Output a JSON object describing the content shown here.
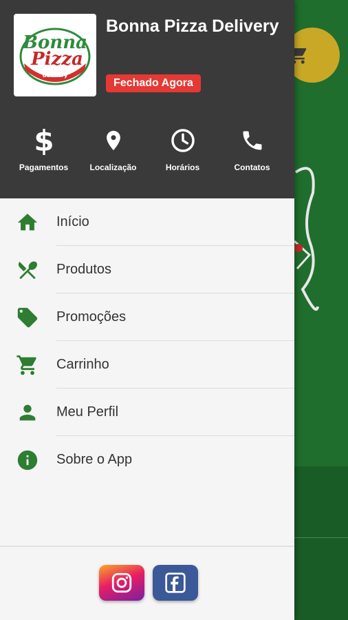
{
  "header": {
    "store_name": "Bonna Pizza Delivery",
    "status": "Fechado Agora",
    "logo_text_top": "Bonna",
    "logo_text_middle": "Pizza",
    "logo_text_bottom": "delivery"
  },
  "quick_actions": [
    {
      "label": "Pagamentos",
      "icon": "dollar-icon"
    },
    {
      "label": "Localização",
      "icon": "location-pin-icon"
    },
    {
      "label": "Horários",
      "icon": "clock-icon"
    },
    {
      "label": "Contatos",
      "icon": "phone-icon"
    }
  ],
  "menu": [
    {
      "label": "Início",
      "icon": "home-icon"
    },
    {
      "label": "Produtos",
      "icon": "utensils-icon"
    },
    {
      "label": "Promoções",
      "icon": "tag-icon"
    },
    {
      "label": "Carrinho",
      "icon": "cart-icon"
    },
    {
      "label": "Meu Perfil",
      "icon": "person-icon"
    },
    {
      "label": "Sobre o App",
      "icon": "info-icon"
    }
  ],
  "social": [
    {
      "name": "instagram",
      "icon": "instagram-icon"
    },
    {
      "name": "facebook",
      "icon": "facebook-icon"
    }
  ],
  "colors": {
    "header_bg": "#3a3a3a",
    "status_badge": "#e53935",
    "menu_icon": "#2e7d32",
    "background_app": "#1f6e2d",
    "cart_fab": "#c9a826"
  }
}
